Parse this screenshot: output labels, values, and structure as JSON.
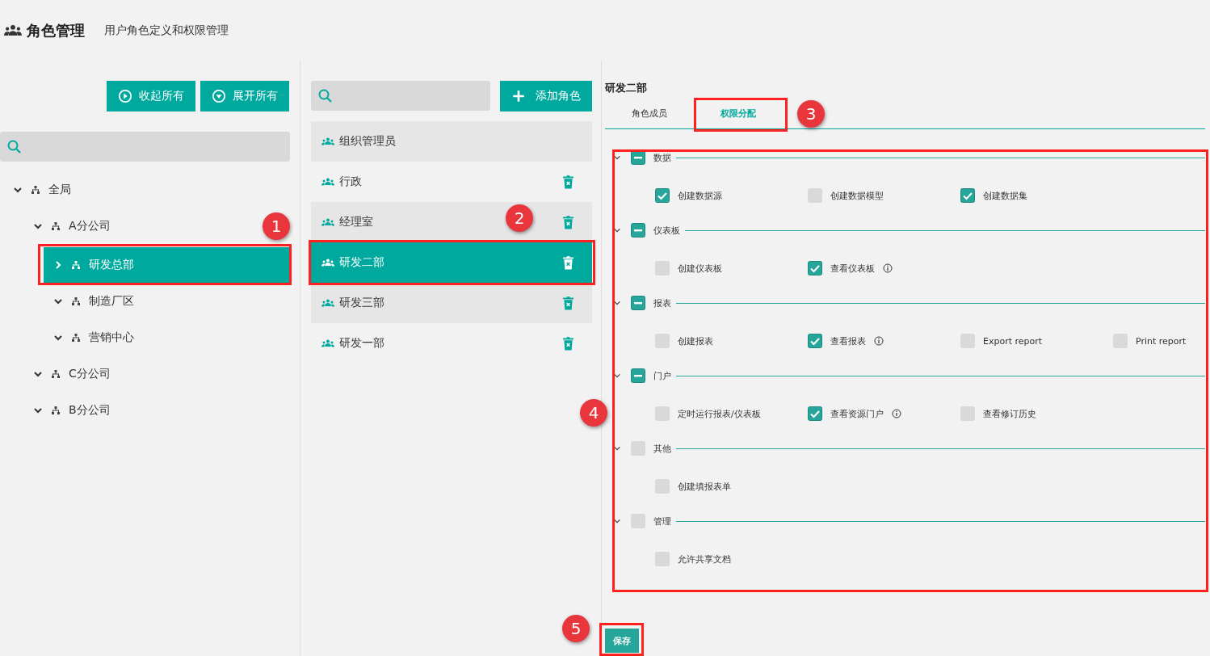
{
  "header": {
    "title": "角色管理",
    "subtitle": "用户角色定义和权限管理"
  },
  "org_panel": {
    "buttons": [
      {
        "kind": "collapse",
        "label": "收起所有"
      },
      {
        "kind": "expand",
        "label": "展开所有"
      }
    ],
    "tree": [
      {
        "label": "全局",
        "expanded": true,
        "selected": false,
        "children": [
          {
            "label": "A分公司",
            "expanded": true,
            "selected": false,
            "children": [
              {
                "label": "研发总部",
                "expanded": false,
                "selected": true
              },
              {
                "label": "制造厂区",
                "expanded": true,
                "selected": false
              },
              {
                "label": "营销中心",
                "expanded": true,
                "selected": false
              }
            ]
          },
          {
            "label": "C分公司",
            "expanded": true,
            "selected": false
          },
          {
            "label": "B分公司",
            "expanded": true,
            "selected": false
          }
        ]
      }
    ]
  },
  "roles_panel": {
    "add_button": "添加角色",
    "roles": [
      {
        "name": "组织管理员",
        "selected": false,
        "deletable": false
      },
      {
        "name": "行政",
        "selected": false,
        "deletable": true
      },
      {
        "name": "经理室",
        "selected": false,
        "deletable": true
      },
      {
        "name": "研发二部",
        "selected": true,
        "deletable": true
      },
      {
        "name": "研发三部",
        "selected": false,
        "deletable": true
      },
      {
        "name": "研发一部",
        "selected": false,
        "deletable": true
      }
    ]
  },
  "detail": {
    "title": "研发二部",
    "tabs": [
      {
        "label": "角色成员",
        "selected": false
      },
      {
        "label": "权限分配",
        "selected": true
      }
    ],
    "groups": [
      {
        "name": "数据",
        "partial": true,
        "items": [
          {
            "label": "创建数据源",
            "checked": true,
            "info": false
          },
          {
            "label": "创建数据模型",
            "checked": false,
            "info": false
          },
          {
            "label": "创建数据集",
            "checked": true,
            "info": false
          }
        ]
      },
      {
        "name": "仪表板",
        "partial": true,
        "items": [
          {
            "label": "创建仪表板",
            "checked": false,
            "info": false
          },
          {
            "label": "查看仪表板",
            "checked": true,
            "info": true
          }
        ]
      },
      {
        "name": "报表",
        "partial": true,
        "items": [
          {
            "label": "创建报表",
            "checked": false,
            "info": false
          },
          {
            "label": "查看报表",
            "checked": true,
            "info": true
          },
          {
            "label": "Export report",
            "checked": false,
            "info": false
          },
          {
            "label": "Print report",
            "checked": false,
            "info": false
          }
        ]
      },
      {
        "name": "门户",
        "partial": true,
        "items": [
          {
            "label": "定时运行报表/仪表板",
            "checked": false,
            "info": false
          },
          {
            "label": "查看资源门户",
            "checked": true,
            "info": true
          },
          {
            "label": "查看修订历史",
            "checked": false,
            "info": false
          }
        ]
      },
      {
        "name": "其他",
        "partial": false,
        "items": [
          {
            "label": "创建填报表单",
            "checked": false,
            "info": false
          }
        ]
      },
      {
        "name": "管理",
        "partial": false,
        "items": [
          {
            "label": "允许共享文档",
            "checked": false,
            "info": false
          }
        ]
      }
    ],
    "save_button": "保存"
  },
  "callouts": [
    "1",
    "2",
    "3",
    "4",
    "5"
  ]
}
